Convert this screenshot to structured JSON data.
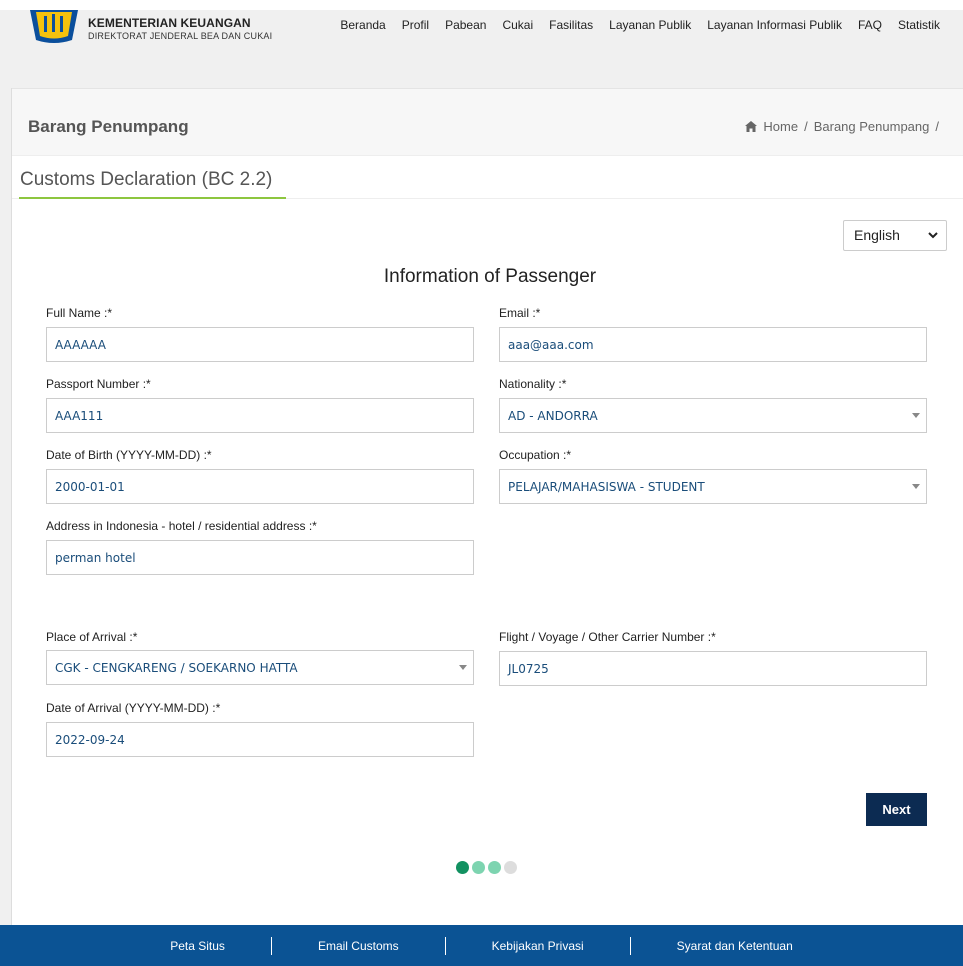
{
  "header": {
    "brand_title": "KEMENTERIAN KEUANGAN",
    "brand_subtitle": "DIREKTORAT JENDERAL BEA DAN CUKAI",
    "nav": [
      "Beranda",
      "Profil",
      "Pabean",
      "Cukai",
      "Fasilitas",
      "Layanan Publik",
      "Layanan Informasi Publik",
      "FAQ",
      "Statistik"
    ]
  },
  "page": {
    "title": "Barang Penumpang",
    "breadcrumb": {
      "home": "Home",
      "sep1": "/",
      "current": "Barang Penumpang",
      "sep2": "/"
    },
    "tab": "Customs Declaration (BC 2.2)",
    "language": "English",
    "section_title": "Information of Passenger"
  },
  "form": {
    "full_name": {
      "label": "Full Name :*",
      "value": "AAAAAA"
    },
    "email": {
      "label": "Email :*",
      "value": "aaa@aaa.com"
    },
    "passport": {
      "label": "Passport Number :*",
      "value": "AAA111"
    },
    "nationality": {
      "label": "Nationality :*",
      "value": "AD - ANDORRA"
    },
    "dob": {
      "label": "Date of Birth (YYYY-MM-DD) :*",
      "value": "2000-01-01"
    },
    "occupation": {
      "label": "Occupation :*",
      "value": "PELAJAR/MAHASISWA - STUDENT"
    },
    "address": {
      "label": "Address in Indonesia - hotel / residential address :*",
      "value": "perman hotel"
    },
    "place_of_arrival": {
      "label": "Place of Arrival :*",
      "value": "CGK - CENGKARENG / SOEKARNO HATTA"
    },
    "flight": {
      "label": "Flight / Voyage / Other Carrier Number :*",
      "value": "JL0725"
    },
    "date_of_arrival": {
      "label": "Date of Arrival (YYYY-MM-DD) :*",
      "value": "2022-09-24"
    }
  },
  "actions": {
    "next": "Next"
  },
  "progress": {
    "current_step": 1,
    "total_steps": 4,
    "colors": [
      "#129161",
      "#7dd4b0",
      "#7dd4b0",
      "#dddddd"
    ]
  },
  "footer": {
    "links": [
      "Peta Situs",
      "Email Customs",
      "Kebijakan Privasi",
      "Syarat dan Ketentuan"
    ]
  },
  "colors": {
    "footer_bg": "#0b5394",
    "button_bg": "#0c2b52",
    "tab_underline": "#8dc63f",
    "input_text": "#1a4d7a"
  }
}
